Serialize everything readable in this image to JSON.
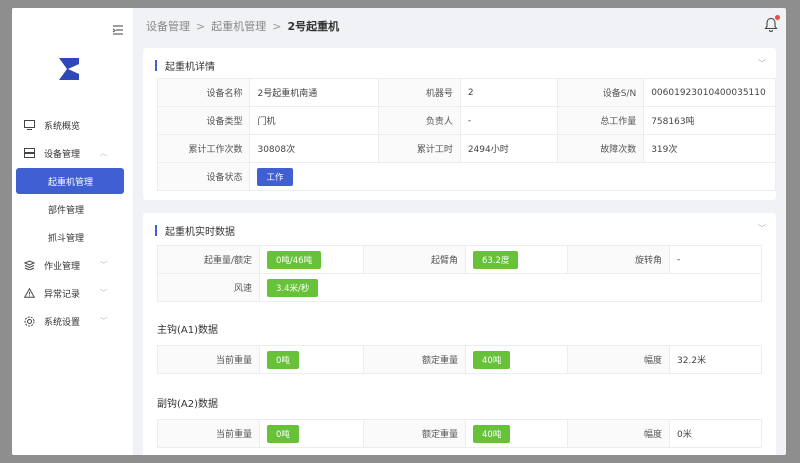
{
  "breadcrumb": {
    "items": [
      "设备管理",
      "起重机管理"
    ],
    "current": "2号起重机",
    "sep": ">"
  },
  "sidebar": {
    "items": [
      {
        "label": "系统概览",
        "icon": "monitor-icon"
      },
      {
        "label": "设备管理",
        "icon": "device-icon",
        "expanded": true
      },
      {
        "label": "起重机管理",
        "active": true
      },
      {
        "label": "部件管理"
      },
      {
        "label": "抓斗管理"
      },
      {
        "label": "作业管理",
        "icon": "task-icon"
      },
      {
        "label": "异常记录",
        "icon": "warning-icon"
      },
      {
        "label": "系统设置",
        "icon": "settings-icon"
      }
    ]
  },
  "details": {
    "title": "起重机详情",
    "rows": [
      [
        {
          "k": "设备名称",
          "v": "2号起重机南通"
        },
        {
          "k": "机器号",
          "v": "2"
        },
        {
          "k": "设备S/N",
          "v": "00601923010400035110"
        }
      ],
      [
        {
          "k": "设备类型",
          "v": "门机"
        },
        {
          "k": "负责人",
          "v": "-"
        },
        {
          "k": "总工作量",
          "v": "758163吨"
        }
      ],
      [
        {
          "k": "累计工作次数",
          "v": "30808次"
        },
        {
          "k": "累计工时",
          "v": "2494小时"
        },
        {
          "k": "故障次数",
          "v": "319次"
        }
      ]
    ],
    "status_label": "设备状态",
    "status_value": "工作"
  },
  "realtime": {
    "title": "起重机实时数据",
    "row1": [
      {
        "k": "起重量/额定",
        "v": "0吨/46吨"
      },
      {
        "k": "起臂角",
        "v": "63.2度"
      },
      {
        "k": "旋转角",
        "v": "-"
      }
    ],
    "wind_label": "风速",
    "wind_value": "3.4米/秒",
    "main_title": "主钩(A1)数据",
    "main": [
      {
        "k": "当前重量",
        "v": "0吨"
      },
      {
        "k": "额定重量",
        "v": "40吨"
      },
      {
        "k": "幅度",
        "v": "32.2米"
      }
    ],
    "aux_title": "副钩(A2)数据",
    "aux": [
      {
        "k": "当前重量",
        "v": "0吨"
      },
      {
        "k": "额定重量",
        "v": "40吨"
      },
      {
        "k": "幅度",
        "v": "0米"
      }
    ]
  },
  "colors": {
    "primary": "#3f5fd3",
    "success": "#67c23a",
    "alert": "#f04a40"
  }
}
